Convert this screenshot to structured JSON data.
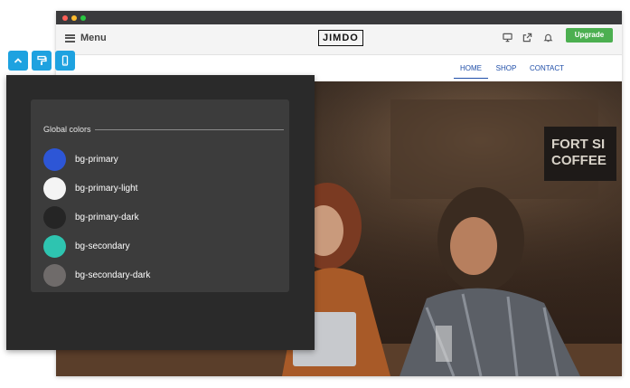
{
  "toolbar": {
    "menu_label": "Menu",
    "logo_text": "JIMDO",
    "upgrade_label": "Upgrade"
  },
  "site_nav": {
    "items": [
      "HOME",
      "SHOP",
      "CONTACT"
    ],
    "active": "HOME"
  },
  "hero": {
    "sign_text": "FORT SI\nCOFFEE"
  },
  "global_colors_panel": {
    "title": "Global colors",
    "colors": [
      {
        "name": "bg-primary",
        "hex": "#2d56d6"
      },
      {
        "name": "bg-primary-light",
        "hex": "#f4f4f4"
      },
      {
        "name": "bg-primary-dark",
        "hex": "#252525"
      },
      {
        "name": "bg-secondary",
        "hex": "#2ec4b0"
      },
      {
        "name": "bg-secondary-dark",
        "hex": "#6f6b6a"
      }
    ]
  },
  "side_tools": [
    "chevron-up-icon",
    "paint-roller-icon",
    "mobile-icon"
  ],
  "colors": {
    "upgrade": "#4caf50",
    "nav_link": "#1f4ea8",
    "tool_chip": "#1ea2e0",
    "panel_bg": "#2a2a2a"
  }
}
